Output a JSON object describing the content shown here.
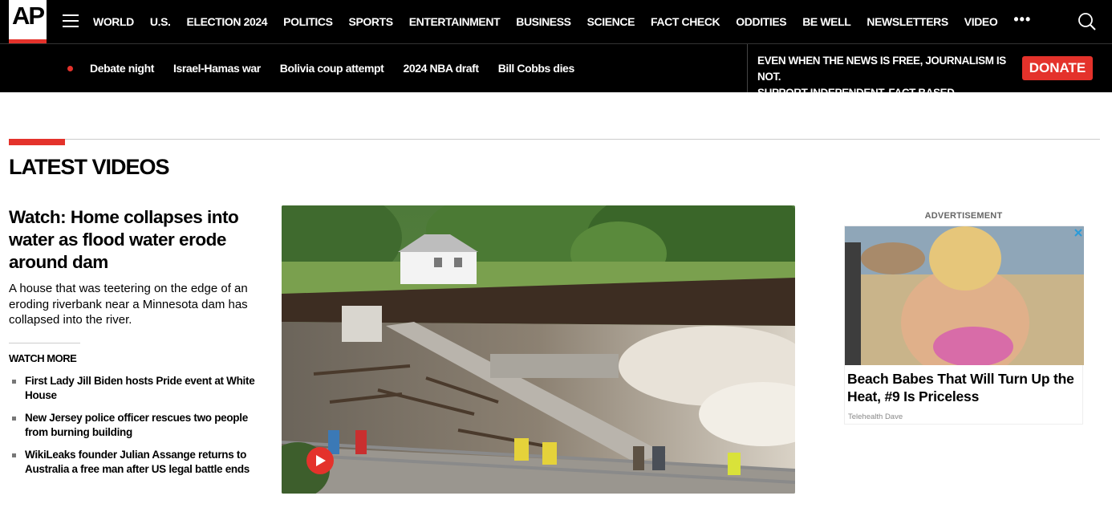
{
  "logo": {
    "text": "AP"
  },
  "nav": {
    "links": [
      "WORLD",
      "U.S.",
      "ELECTION 2024",
      "POLITICS",
      "SPORTS",
      "ENTERTAINMENT",
      "BUSINESS",
      "SCIENCE",
      "FACT CHECK",
      "ODDITIES",
      "BE WELL",
      "NEWSLETTERS",
      "VIDEO"
    ],
    "more": "•••"
  },
  "hotlinks": [
    "Debate night",
    "Israel-Hamas war",
    "Bolivia coup attempt",
    "2024 NBA draft",
    "Bill Cobbs dies"
  ],
  "promo": {
    "line1": "EVEN WHEN THE NEWS IS FREE, JOURNALISM IS NOT.",
    "line2": "SUPPORT INDEPENDENT, FACT-BASED JOURNALISM.",
    "donate_label": "DONATE"
  },
  "section": {
    "title": "LATEST VIDEOS"
  },
  "lead": {
    "headline": "Watch: Home collapses into water as flood water erode around dam",
    "summary": "A house that was teetering on the edge of an eroding riverbank near a Minnesota dam has collapsed into the river."
  },
  "watch_more": {
    "label": "WATCH MORE",
    "items": [
      "First Lady Jill Biden hosts Pride event at White House",
      "New Jersey police officer rescues two people from burning building",
      "WikiLeaks founder Julian Assange returns to Australia a free man after US legal battle ends"
    ]
  },
  "ad": {
    "label": "ADVERTISEMENT",
    "headline": "Beach Babes That Will Turn Up the Heat, #9 Is Priceless",
    "source": "Telehealth Dave"
  },
  "colors": {
    "accent": "#e4322b",
    "nav_bg": "#000000"
  }
}
